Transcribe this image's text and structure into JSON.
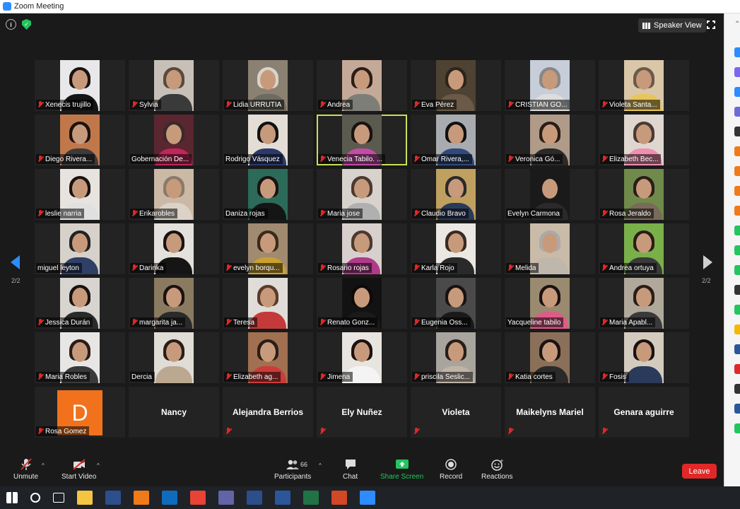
{
  "window": {
    "title": "Zoom Meeting"
  },
  "header": {
    "speaker_view_label": "Speaker View"
  },
  "pagination": {
    "left": "2/2",
    "right": "2/2"
  },
  "participants": [
    {
      "name": "Xenecis trujillo",
      "muted": true,
      "bg": "#e8e8ea",
      "body": "#151515",
      "hair": "#1a1211"
    },
    {
      "name": "Sylvia",
      "muted": true,
      "bg": "#c6c0b8",
      "body": "#3a3a3a",
      "hair": "#5a4a3c"
    },
    {
      "name": "Lidia URRUTIA",
      "muted": true,
      "bg": "#8b8172",
      "body": "#6d6a60",
      "hair": "#d7d3cd"
    },
    {
      "name": "Andrea",
      "muted": true,
      "bg": "#c5a998",
      "body": "#7e7e78",
      "hair": "#2a1d17"
    },
    {
      "name": "Eva Pérez",
      "muted": true,
      "bg": "#4e4232",
      "body": "#6b5a48",
      "hair": "#2d241a"
    },
    {
      "name": "CRISTIAN GO...",
      "muted": true,
      "bg": "#c7ced9",
      "body": "#ddd",
      "hair": "#888"
    },
    {
      "name": "Violeta Santa...",
      "muted": true,
      "bg": "#d9c7a8",
      "body": "#e8c55a",
      "hair": "#6a5a4a"
    },
    {
      "name": "Diego Rivera...",
      "muted": true,
      "bg": "#c0784a",
      "body": "#3b3b3b",
      "hair": "#1a1211"
    },
    {
      "name": "Gobernación De...",
      "muted": false,
      "bg": "#5a2630",
      "body": "#c0265b",
      "hair": "#3a2a2a"
    },
    {
      "name": "Rodrigo Vásquez",
      "muted": false,
      "bg": "#e3ddd5",
      "body": "#2b3a6a",
      "hair": "#111"
    },
    {
      "name": "Venecia Tabilo. ...",
      "muted": true,
      "bg": "#5a5a4e",
      "body": "#c44ca4",
      "hair": "#1a1211",
      "active": true
    },
    {
      "name": "Omar Rivera,...",
      "muted": true,
      "bg": "#a8acb0",
      "body": "#304a7a",
      "hair": "#111"
    },
    {
      "name": "Veronica Gó...",
      "muted": true,
      "bg": "#b09a88",
      "body": "#2a2a2a",
      "hair": "#2a1d17"
    },
    {
      "name": "Elizabeth Bec...",
      "muted": true,
      "bg": "#dfd6d0",
      "body": "#ef8fb0",
      "hair": "#4a3a30"
    },
    {
      "name": "leslie narria",
      "muted": true,
      "bg": "#e7e3df",
      "body": "#e0e0e0",
      "hair": "#1a1211"
    },
    {
      "name": "Erikarobles",
      "muted": true,
      "bg": "#cbb9a6",
      "body": "#dcd2c8",
      "hair": "#8a7a6a"
    },
    {
      "name": "Daniza rojas",
      "muted": false,
      "bg": "#2c6a5a",
      "body": "#151515",
      "hair": "#1a1211"
    },
    {
      "name": "Maria jose",
      "muted": true,
      "bg": "#d8d2cc",
      "body": "#b0b0b0",
      "hair": "#4a3a30"
    },
    {
      "name": "Claudio Bravo",
      "muted": true,
      "bg": "#c0a060",
      "body": "#2a3a5a",
      "hair": "#2a2a2a"
    },
    {
      "name": "Evelyn Carmona",
      "muted": false,
      "bg": "#1a1a1a",
      "body": "#2a2a2a",
      "hair": "#1a1a1a"
    },
    {
      "name": "Rosa Jeraldo",
      "muted": true,
      "bg": "#6f8a4a",
      "body": "#7a6a5a",
      "hair": "#2a1d17"
    },
    {
      "name": "miguel leyton",
      "muted": false,
      "bg": "#d7d1cb",
      "body": "#2f3f66",
      "hair": "#222"
    },
    {
      "name": "Darinka",
      "muted": true,
      "bg": "#e4e0dc",
      "body": "#151515",
      "hair": "#1a1211"
    },
    {
      "name": "evelyn borqu...",
      "muted": true,
      "bg": "#a08a70",
      "body": "#caa030",
      "hair": "#3a2a1a"
    },
    {
      "name": "Rosario rojas",
      "muted": true,
      "bg": "#d8d0cc",
      "body": "#b03a8a",
      "hair": "#4a3a30"
    },
    {
      "name": "Karla Rojo",
      "muted": true,
      "bg": "#ebe7e3",
      "body": "#2a2a2a",
      "hair": "#3a2a20"
    },
    {
      "name": "Melida",
      "muted": true,
      "bg": "#c9bba8",
      "body": "#bfb6ac",
      "hair": "#aaa"
    },
    {
      "name": "Andrea ortuya",
      "muted": true,
      "bg": "#7ab04a",
      "body": "#3a3a3a",
      "hair": "#2a1d17"
    },
    {
      "name": "Jessica Durán",
      "muted": true,
      "bg": "#d8d4d0",
      "body": "#2a2a2a",
      "hair": "#1a1211"
    },
    {
      "name": "margarita ja...",
      "muted": true,
      "bg": "#8a7a60",
      "body": "#2a2a2a",
      "hair": "#1a1211"
    },
    {
      "name": "Teresa",
      "muted": true,
      "bg": "#e0dcd8",
      "body": "#c43a3a",
      "hair": "#5a3a2a"
    },
    {
      "name": "Renato Gonz...",
      "muted": true,
      "bg": "#121212",
      "body": "#1a1a1a",
      "hair": "#0f0a08"
    },
    {
      "name": "Eugenia Oss...",
      "muted": true,
      "bg": "#4a4a4a",
      "body": "#1a1a1a",
      "hair": "#1a1211"
    },
    {
      "name": "Yacqueline tabilo",
      "muted": false,
      "bg": "#9a8a70",
      "body": "#e05a8a",
      "hair": "#1a1211"
    },
    {
      "name": "Maria Apabl...",
      "muted": true,
      "bg": "#b0a89a",
      "body": "#3a3a3a",
      "hair": "#2a1d17"
    },
    {
      "name": "Maria Robles",
      "muted": true,
      "bg": "#e8e6e4",
      "body": "#3a3a3a",
      "hair": "#2a1d17"
    },
    {
      "name": "Dercia",
      "muted": false,
      "bg": "#e0dcd6",
      "body": "#bca890",
      "hair": "#2a1d17"
    },
    {
      "name": "Elizabeth ag...",
      "muted": true,
      "bg": "#a07050",
      "body": "#cc3a3a",
      "hair": "#2a1d17"
    },
    {
      "name": "Jimena",
      "muted": true,
      "bg": "#e8e4e0",
      "body": "#f4f4f4",
      "hair": "#1a1211"
    },
    {
      "name": "priscila Seslic...",
      "muted": true,
      "bg": "#a8a49e",
      "body": "#c0b4a8",
      "hair": "#2a1d17"
    },
    {
      "name": "Katia cortes",
      "muted": true,
      "bg": "#8a7058",
      "body": "#2a2a2a",
      "hair": "#1a1211"
    },
    {
      "name": "Fosis",
      "muted": true,
      "bg": "#d4cbbf",
      "body": "#2a3a5a",
      "hair": "#1a1211"
    },
    {
      "name": "Rosa Gomez",
      "muted": true,
      "avatar": "D"
    },
    {
      "name": "Nancy",
      "muted": false,
      "nameonly": true
    },
    {
      "name": "Alejandra Berrios",
      "muted": true,
      "nameonly": true
    },
    {
      "name": "Ely Nuñez",
      "muted": true,
      "nameonly": true
    },
    {
      "name": "Violeta",
      "muted": true,
      "nameonly": true
    },
    {
      "name": "Maikelyns Mariel",
      "muted": true,
      "nameonly": true
    },
    {
      "name": "Genara aguirre",
      "muted": true,
      "nameonly": true
    }
  ],
  "toolbar": {
    "unmute": "Unmute",
    "start_video": "Start Video",
    "participants": "Participants",
    "participants_count": "66",
    "chat": "Chat",
    "share_screen": "Share Screen",
    "record": "Record",
    "reactions": "Reactions",
    "leave": "Leave"
  },
  "colors": {
    "accent": "#2d8cff",
    "share": "#22c55e",
    "leave": "#e02828",
    "muted": "#e02828"
  },
  "taskbar_apps": [
    {
      "name": "windows-start",
      "color": "#ffffff"
    },
    {
      "name": "search",
      "color": "#ffffff"
    },
    {
      "name": "task-view",
      "color": "#ffffff"
    },
    {
      "name": "file-explorer",
      "color": "#f5c542"
    },
    {
      "name": "photoshop",
      "color": "#2c4f8c"
    },
    {
      "name": "vlc",
      "color": "#f07a1a"
    },
    {
      "name": "outlook",
      "color": "#0f6cbd"
    },
    {
      "name": "chrome",
      "color": "#e84335"
    },
    {
      "name": "teams",
      "color": "#6264a7"
    },
    {
      "name": "photoshop-2",
      "color": "#2c4f8c"
    },
    {
      "name": "word",
      "color": "#2b579a"
    },
    {
      "name": "excel",
      "color": "#217346"
    },
    {
      "name": "powerpoint",
      "color": "#d24726"
    },
    {
      "name": "zoom",
      "color": "#2d8cff"
    }
  ]
}
